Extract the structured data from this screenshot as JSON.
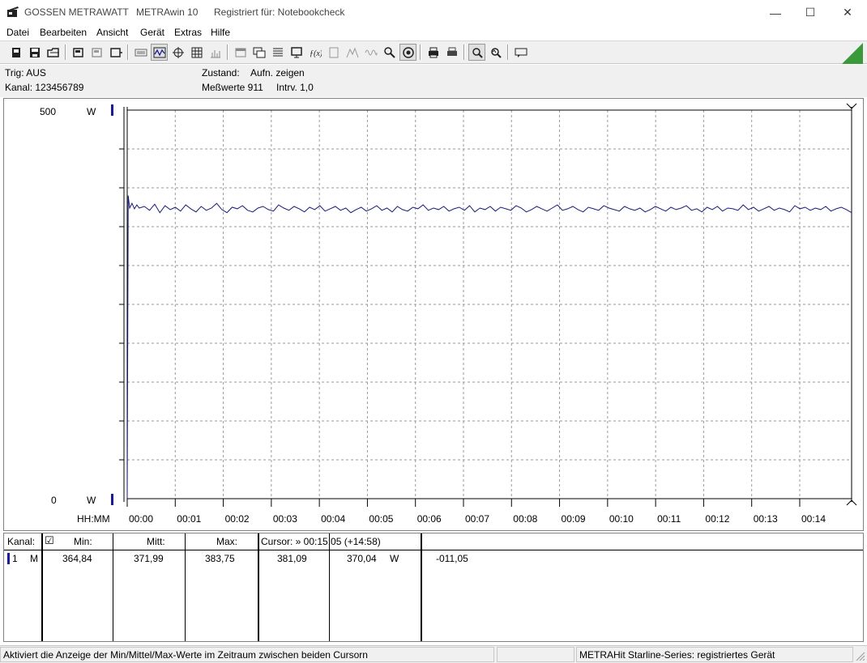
{
  "window": {
    "brand": "GOSSEN METRAWATT",
    "app_name": "METRAwin 10",
    "registered": "Registriert für: Notebookcheck",
    "minimize": "—",
    "maximize": "☐",
    "close": "✕"
  },
  "menu": {
    "items": [
      "Datei",
      "Bearbeiten",
      "Ansicht",
      "Gerät",
      "Extras",
      "Hilfe"
    ]
  },
  "info": {
    "trig": "Trig: AUS",
    "kanal": "Kanal: 123456789",
    "zustand_label": "Zustand:",
    "zustand_value": "Aufn. zeigen",
    "messwerte": "Meßwerte 911",
    "intrv": "Intrv. 1,0"
  },
  "chart_data": {
    "type": "line",
    "ylim": [
      0,
      500
    ],
    "y_top_label": "500",
    "y_bottom_label": "0",
    "y_unit": "W",
    "xlabel": "HH:MM",
    "x_ticks": [
      "00:00",
      "00:01",
      "00:02",
      "00:03",
      "00:04",
      "00:05",
      "00:06",
      "00:07",
      "00:08",
      "00:09",
      "00:10",
      "00:11",
      "00:12",
      "00:13",
      "00:14"
    ],
    "x_range_minutes": [
      0,
      15.08
    ],
    "grid": true,
    "line_color": "#1a1a7a",
    "series": [
      {
        "values_start": [
          0,
          390,
          374,
          380,
          373,
          378
        ],
        "values_steady": [
          374,
          376,
          371,
          379,
          368,
          377,
          372,
          375,
          370,
          378,
          373,
          369,
          376,
          371,
          374,
          380,
          372,
          368,
          375,
          373,
          377,
          371,
          369,
          374,
          376,
          372,
          370,
          378,
          374,
          371,
          376,
          373,
          369,
          375,
          372,
          377,
          370,
          373,
          376,
          371,
          374,
          368,
          372,
          375,
          370,
          373,
          377,
          371,
          374,
          369,
          376,
          372,
          370,
          375,
          373,
          378,
          371,
          374,
          372,
          376,
          370,
          373,
          375,
          371,
          377,
          369,
          374,
          372,
          376,
          370,
          375,
          373,
          371,
          377,
          374,
          369,
          372,
          376,
          373,
          370,
          374,
          378,
          371,
          373,
          376,
          372,
          369,
          375,
          373,
          371,
          377,
          374,
          372,
          370,
          376,
          373,
          371,
          374,
          369,
          372,
          376,
          373,
          370,
          375,
          372,
          374,
          377,
          371,
          373,
          369,
          375,
          372,
          376,
          370,
          374,
          373,
          371,
          378,
          372,
          375,
          370,
          373,
          376,
          371,
          374,
          372,
          369,
          377,
          373,
          375,
          371,
          374,
          372,
          376,
          370,
          373,
          375,
          372,
          368
        ]
      }
    ]
  },
  "table": {
    "header_kanal": "Kanal:",
    "header_check": "☑",
    "header_min": "Min:",
    "header_mitt": "Mitt:",
    "header_max": "Max:",
    "cursor": "Cursor: » 00:15:05 (+14:58)",
    "row": {
      "channel": "1",
      "mode": "M",
      "min": "364,84",
      "mitt": "371,99",
      "max": "383,75",
      "cursor_value": "381,09",
      "cursor_value2": "370,04",
      "unit": "W",
      "diff": "-011,05"
    },
    "channel_color": "#1a1a9a"
  },
  "status": {
    "hint": "Aktiviert die Anzeige der Min/Mittel/Max-Werte im Zeitraum zwischen beiden Cursorn",
    "device": "METRAHit Starline-Series: registriertes Gerät"
  }
}
